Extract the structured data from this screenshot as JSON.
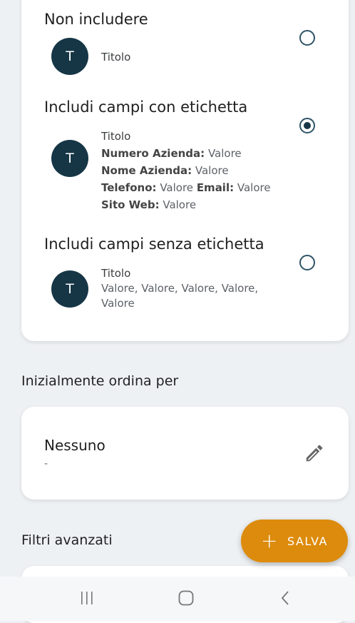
{
  "display_options": [
    {
      "title": "Non includere",
      "selected": false,
      "avatar_letter": "T",
      "preview_title": "Titolo"
    },
    {
      "title": "Includi campi con etichetta",
      "selected": true,
      "avatar_letter": "T",
      "preview_title": "Titolo",
      "fields": {
        "company_number_label": "Numero Azienda:",
        "company_number_value": "Valore",
        "company_name_label": "Nome Azienda:",
        "company_name_value": "Valore",
        "phone_label": "Telefono:",
        "phone_value": "Valore",
        "email_label": "Email:",
        "email_value": "Valore",
        "website_label": "Sito Web:",
        "website_value": "Valore"
      }
    },
    {
      "title": "Includi campi senza etichetta",
      "selected": false,
      "avatar_letter": "T",
      "preview_title": "Titolo",
      "values_line1": "Valore, Valore, Valore, Valore,",
      "values_line2": "Valore"
    }
  ],
  "sort_section": {
    "title": "Inizialmente ordina per",
    "value": "Nessuno",
    "subvalue": "-",
    "edit_icon": "pencil-icon"
  },
  "filters_section": {
    "title": "Filtri avanzati"
  },
  "fab": {
    "label": "SALVA",
    "icon": "plus-icon",
    "color": "#dd8b0c"
  },
  "nav_bar": {
    "recent_icon": "recent-apps-icon",
    "home_icon": "home-icon",
    "back_icon": "back-icon"
  }
}
